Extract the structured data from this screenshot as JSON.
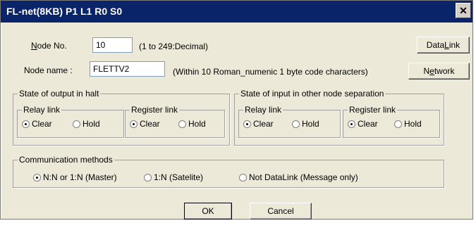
{
  "window": {
    "title": "FL-net(8KB)  P1 L1 R0 S0",
    "close_glyph": "✕"
  },
  "node_no": {
    "label_u": "N",
    "label_rest": "ode No.",
    "value": "10",
    "hint": "(1 to 249:Decimal)"
  },
  "node_name": {
    "label": "Node name :",
    "value": "FLETTV2",
    "hint": "(Within 10 Roman_numenic 1 byte code characters)"
  },
  "buttons": {
    "datalink_pre": "Data",
    "datalink_u": "L",
    "datalink_post": "ink",
    "network_pre": "N",
    "network_u": "e",
    "network_post": "twork",
    "ok": "OK",
    "cancel": "Cancel"
  },
  "halt_group": {
    "label": "State of output in halt",
    "relay": {
      "label": "Relay link",
      "clear": "Clear",
      "hold": "Hold",
      "selected": "clear"
    },
    "register": {
      "label": "Register link",
      "clear": "Clear",
      "hold": "Hold",
      "selected": "clear"
    }
  },
  "separation_group": {
    "label": "State of input in other node separation",
    "relay": {
      "label": "Relay link",
      "clear": "Clear",
      "hold": "Hold",
      "selected": "clear"
    },
    "register": {
      "label": "Register link",
      "clear": "Clear",
      "hold": "Hold",
      "selected": "clear"
    }
  },
  "comm_group": {
    "label": "Communication methods",
    "options": [
      "N:N or 1:N (Master)",
      "1:N (Satelite)",
      "Not DataLink (Message only)"
    ],
    "selected_index": 0
  }
}
